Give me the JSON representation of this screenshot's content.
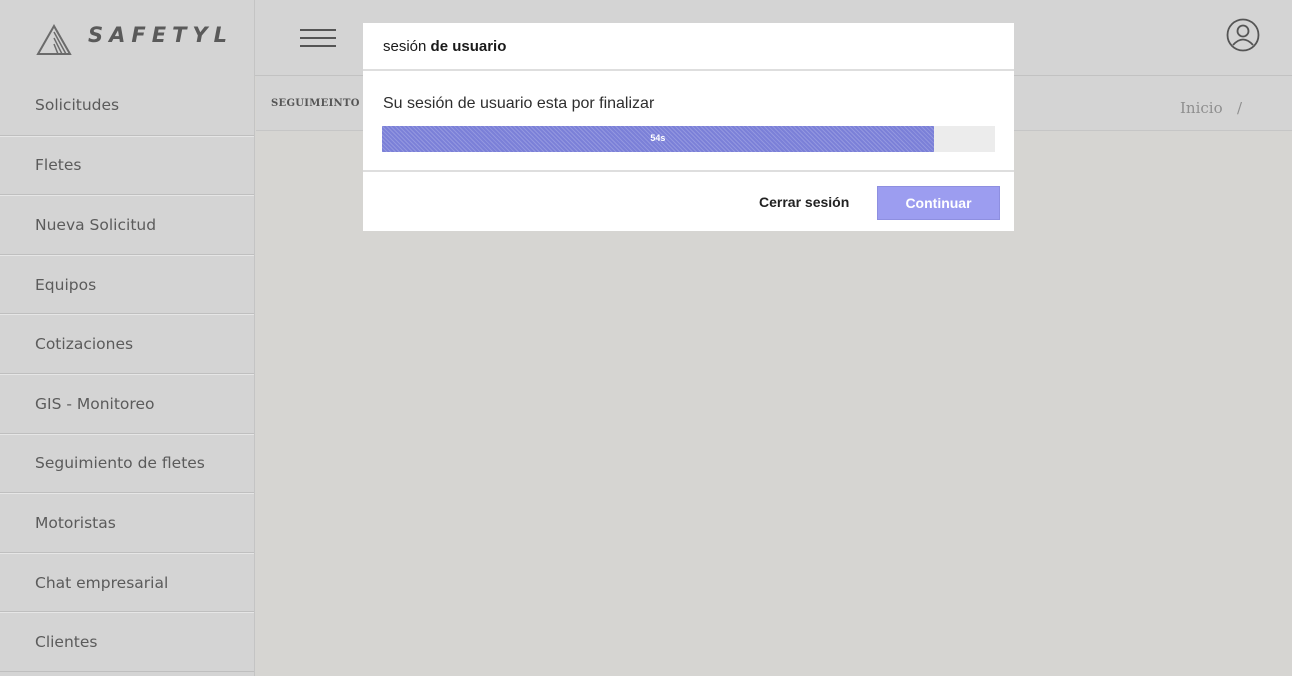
{
  "brand": {
    "name": "SAFETYL",
    "logo_icon": "triangle-logo-icon"
  },
  "header": {
    "menu_icon": "hamburger-icon",
    "user_icon": "user-circle-icon"
  },
  "sidebar": {
    "items": [
      {
        "label": "Solicitudes"
      },
      {
        "label": "Fletes"
      },
      {
        "label": "Nueva Solicitud"
      },
      {
        "label": "Equipos"
      },
      {
        "label": "Cotizaciones"
      },
      {
        "label": "GIS - Monitoreo"
      },
      {
        "label": "Seguimiento de fletes"
      },
      {
        "label": "Motoristas"
      },
      {
        "label": "Chat empresarial"
      },
      {
        "label": "Clientes"
      }
    ]
  },
  "breadcrumb": {
    "page_title": "SEGUIMEINTO",
    "home": "Inicio",
    "separator": "/"
  },
  "modal": {
    "title_prefix": "sesión",
    "title_bold": "de usuario",
    "message": "Su sesión de usuario esta por finalizar",
    "progress": {
      "label": "54s",
      "fraction": 0.9
    },
    "logout_label": "Cerrar sesión",
    "continue_label": "Continuar"
  },
  "colors": {
    "progress_fill": "#7b80d8",
    "continue_button": "#9c9df0",
    "background": "#d6d5d2"
  }
}
